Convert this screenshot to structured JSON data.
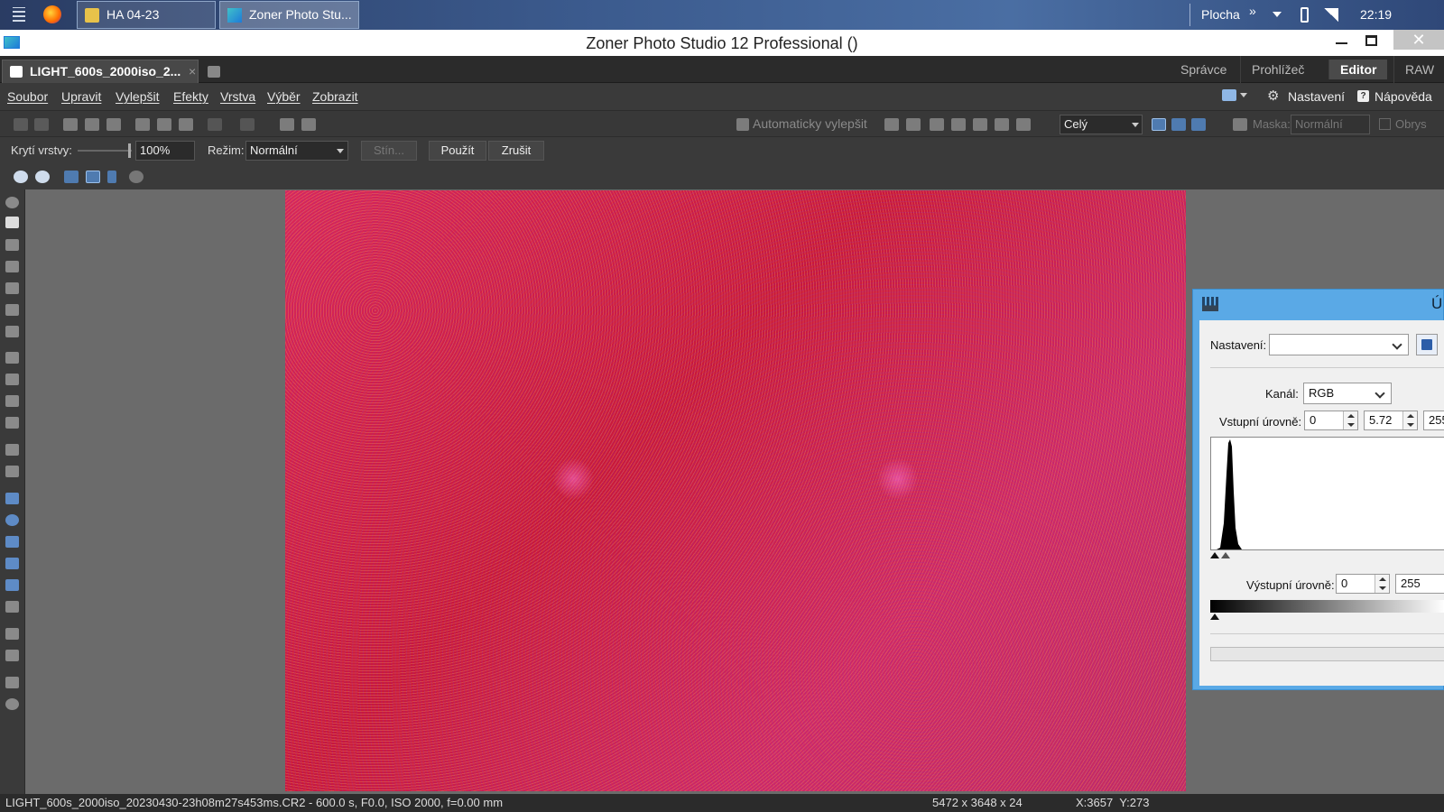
{
  "taskbar": {
    "buttons": [
      {
        "label": "HA 04-23"
      },
      {
        "label": "Zoner Photo Stu..."
      }
    ],
    "desktop_label": "Plocha",
    "more": "»",
    "time": "22:19"
  },
  "window": {
    "title": "Zoner Photo Studio 12 Professional  ()"
  },
  "tabs": {
    "document": "LIGHT_600s_2000iso_2...",
    "close": "×"
  },
  "modules": [
    "Správce",
    "Prohlížeč",
    "Editor",
    "RAW"
  ],
  "menu": [
    "Soubor",
    "Upravit",
    "Vylepšit",
    "Efekty",
    "Vrstva",
    "Výběr",
    "Zobrazit"
  ],
  "menu_right": {
    "settings": "Nastavení",
    "help": "Nápověda"
  },
  "toolbar1": {
    "auto_enhance": "Automaticky vylepšit",
    "zoom_select": "Celý",
    "mask_label": "Maska:",
    "mask_value": "Normální",
    "outline": "Obrys"
  },
  "toolbar2": {
    "opacity_label": "Krytí vrstvy:",
    "opacity_value": "100%",
    "mode_label": "Režim:",
    "mode_value": "Normální",
    "shadow": "Stín...",
    "apply": "Použít",
    "cancel": "Zrušit"
  },
  "levels": {
    "title": "Ú",
    "preset_label": "Nastavení:",
    "preset_value": "",
    "channel_label": "Kanál:",
    "channel_value": "RGB",
    "input_label": "Vstupní úrovně:",
    "input_black": "0",
    "input_gamma": "5.72",
    "input_white": "255",
    "output_label": "Výstupní úrovně:",
    "output_black": "0",
    "output_white": "255"
  },
  "status": {
    "file": "LIGHT_600s_2000iso_20230430-23h08m27s453ms.CR2 - 600.0 s, F0.0, ISO 2000, f=0.00 mm",
    "dimensions": "5472 x 3648 x 24",
    "coords": "X:3657  Y:273"
  },
  "colors": {
    "accent_dialog": "#5aa9e6",
    "photo": "#c8183c"
  }
}
